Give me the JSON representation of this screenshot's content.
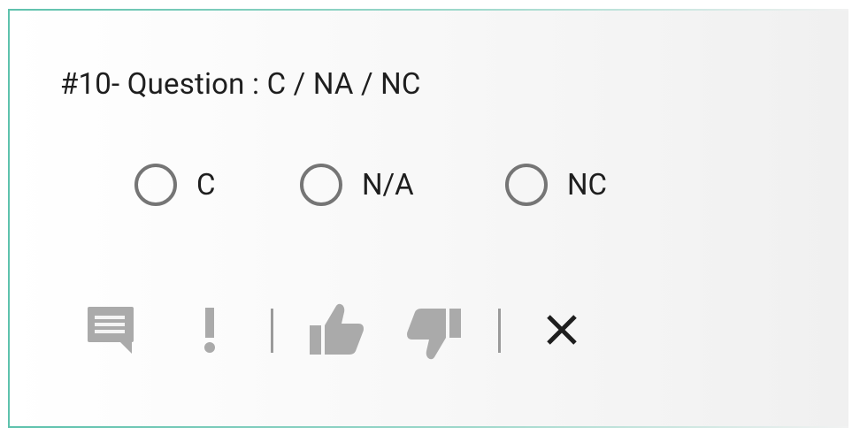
{
  "question": {
    "title": "#10- Question : C / NA / NC"
  },
  "options": [
    {
      "label": "C",
      "selected": false
    },
    {
      "label": "N/A",
      "selected": false
    },
    {
      "label": "NC",
      "selected": false
    }
  ],
  "toolbar": {
    "icons": [
      "comment-icon",
      "exclamation-icon",
      "thumbs-up-icon",
      "thumbs-down-icon",
      "close-icon"
    ]
  },
  "colors": {
    "border_accent": "#5fc2ad",
    "icon_inactive": "#aaaaaa",
    "radio_border": "#757575",
    "text": "#1e1e1e",
    "close_icon": "#1e1e1e"
  }
}
